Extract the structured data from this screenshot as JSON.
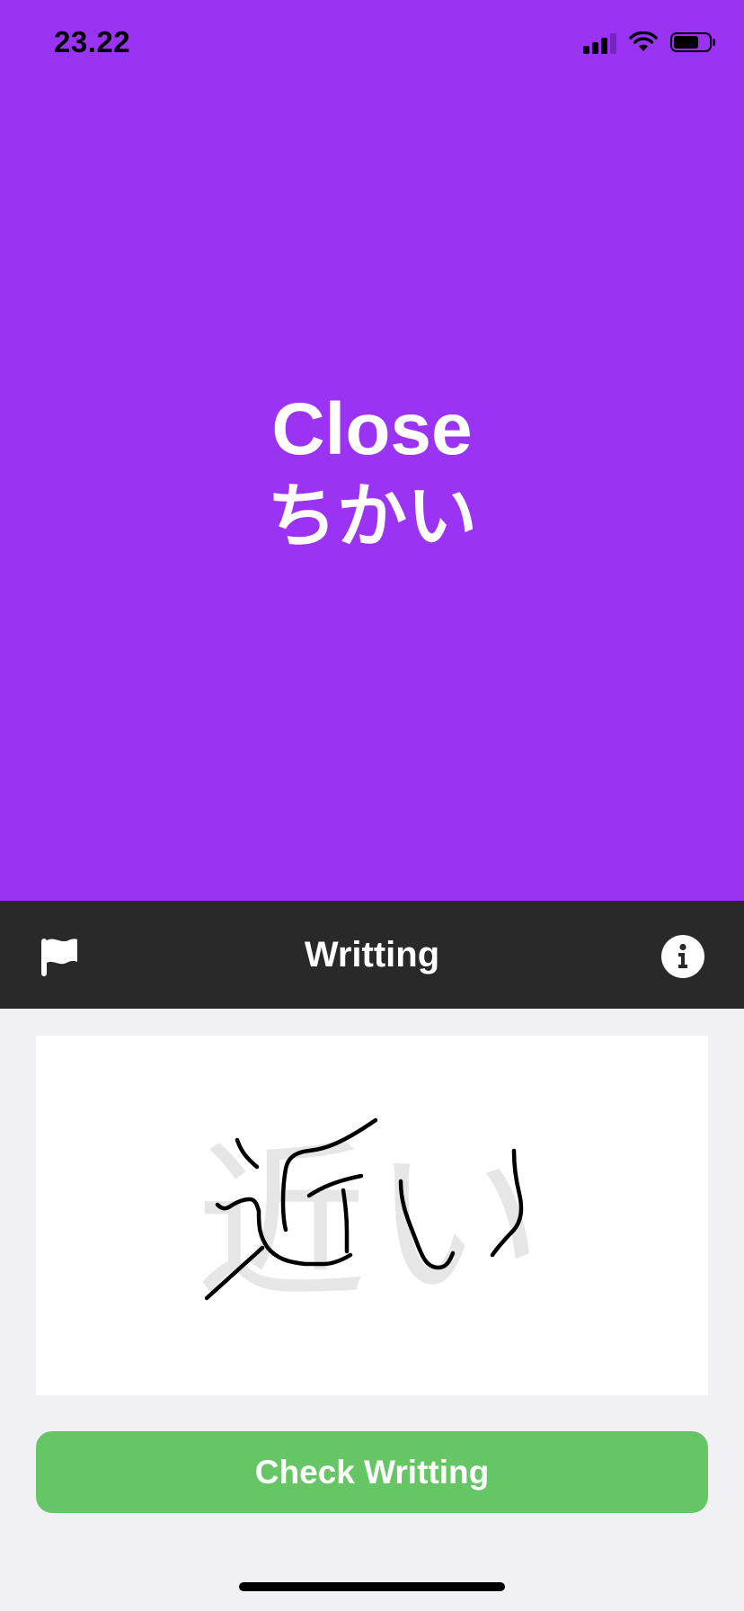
{
  "status_bar": {
    "time": "23.22",
    "icons": [
      "cellular-signal-icon",
      "wifi-icon",
      "battery-icon"
    ],
    "battery_level": 0.72
  },
  "card": {
    "word": "Close",
    "reading": "ちかい",
    "background_color": "#9b33f5"
  },
  "toolbar": {
    "title": "Writting",
    "left_icon": "flag-icon",
    "right_icon": "info-icon"
  },
  "writing_pad": {
    "guide_text": "近い"
  },
  "actions": {
    "check_label": "Check Writting",
    "check_color": "#66c665"
  }
}
